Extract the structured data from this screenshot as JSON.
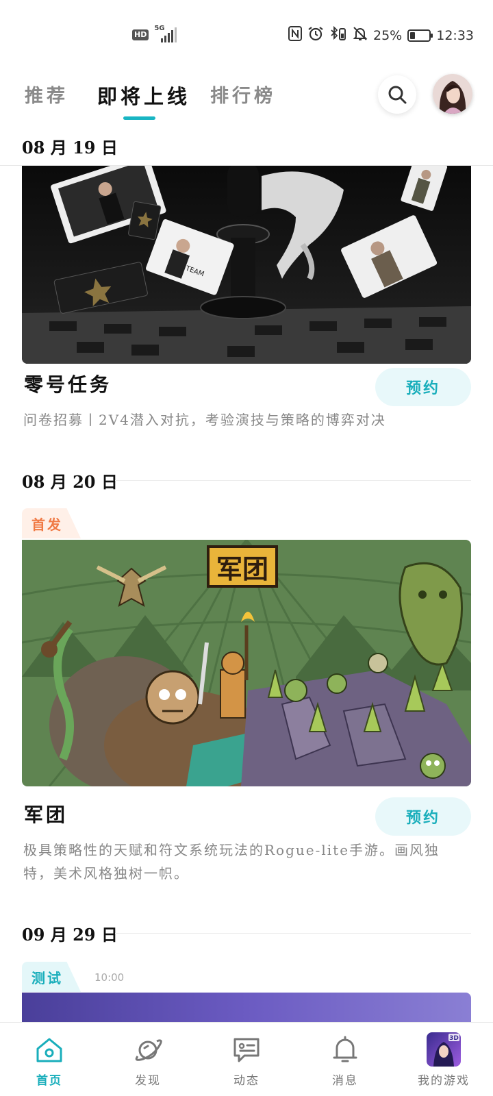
{
  "status_bar": {
    "hd": "HD",
    "network": "5G",
    "battery_percent": "25%",
    "battery_level": 0.25,
    "time": "12:33"
  },
  "tabs": [
    {
      "label": "推荐",
      "active": false
    },
    {
      "label": "即将上线",
      "active": true
    },
    {
      "label": "排行榜",
      "active": false
    }
  ],
  "sections": [
    {
      "date": "08 月 19 日",
      "game": {
        "title": "零号任务",
        "button": "预约",
        "description": "问卷招募丨2V4潜入对抗，考验演技与策略的博弈对决"
      }
    },
    {
      "date": "08 月 20 日",
      "tag": "首发",
      "banner_title": "军团",
      "game": {
        "title": "军团",
        "button": "预约",
        "description": "极具策略性的天赋和符文系统玩法的Rogue-lite手游。画风独特，美术风格独树一帜。"
      }
    },
    {
      "date": "09 月 29 日",
      "tag": "测试",
      "time": "10:00"
    }
  ],
  "bottom_nav": [
    {
      "label": "首页",
      "icon": "home-icon",
      "active": true
    },
    {
      "label": "发现",
      "icon": "planet-icon",
      "active": false
    },
    {
      "label": "动态",
      "icon": "chat-icon",
      "active": false
    },
    {
      "label": "消息",
      "icon": "bell-icon",
      "active": false
    },
    {
      "label": "我的游戏",
      "icon": "game-thumbnail",
      "badge": "3D",
      "active": false
    }
  ],
  "colors": {
    "accent": "#19b5c3",
    "tag_first": "#f07a45",
    "tag_test": "#19aebb"
  }
}
